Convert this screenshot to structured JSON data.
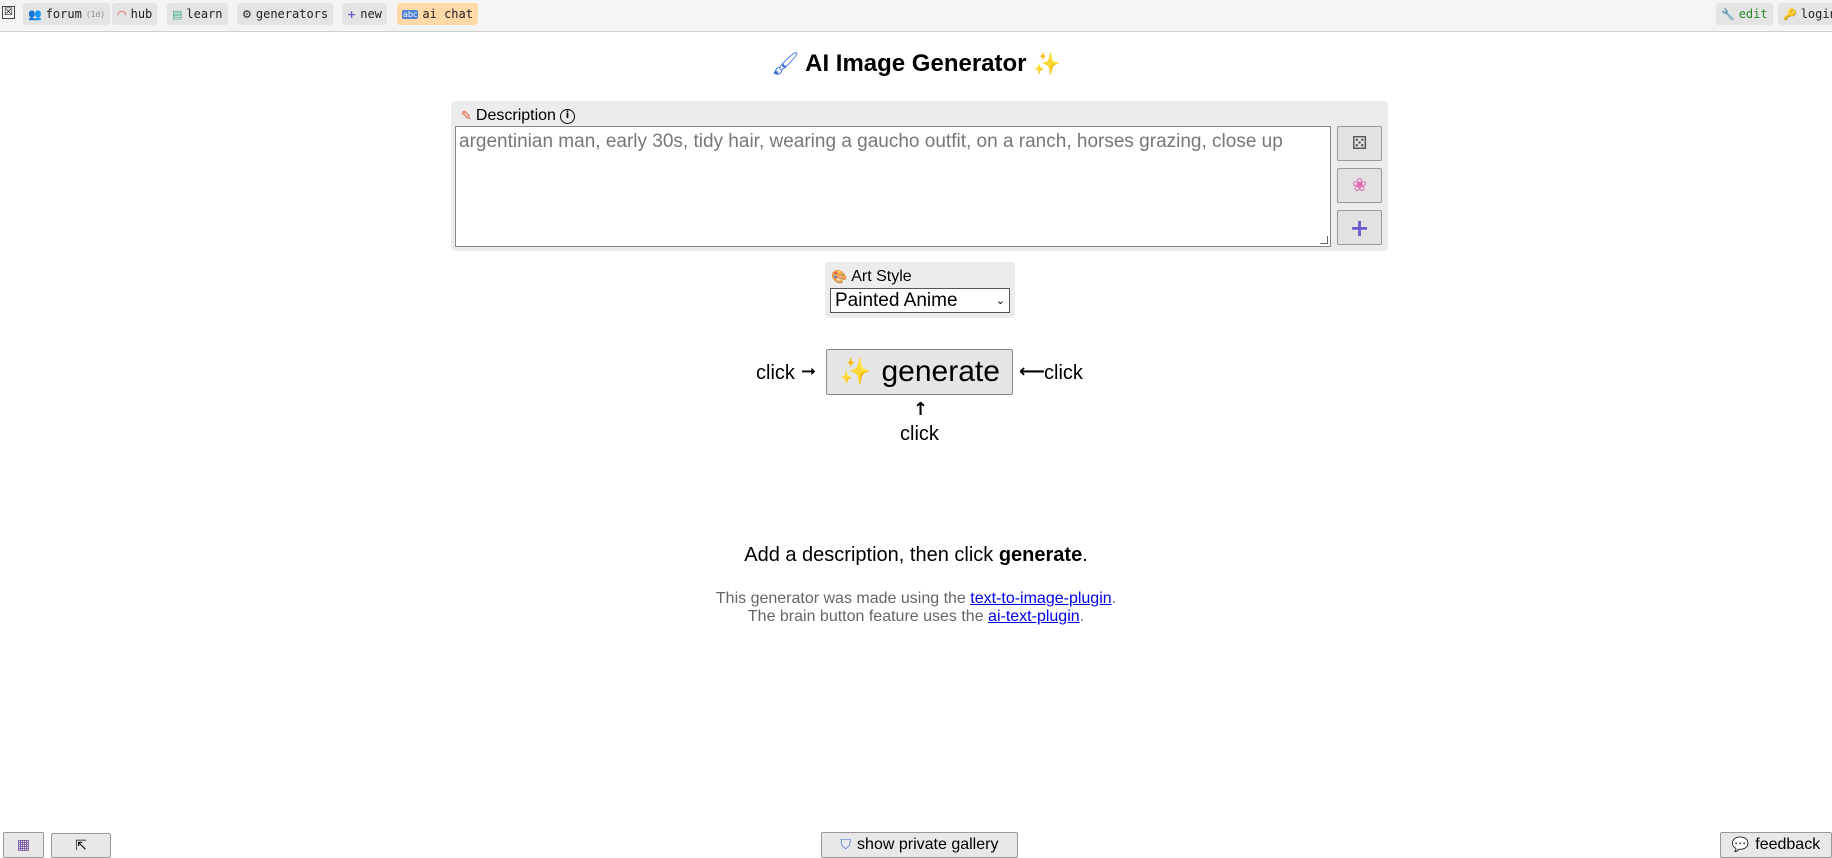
{
  "topbar": {
    "close_icon": "☒",
    "forum": {
      "icon": "people-icon",
      "label": "forum",
      "badge": "(1d)"
    },
    "hub": {
      "icon": "rainbow-icon",
      "label": "hub"
    },
    "learn": {
      "icon": "books-icon",
      "label": "learn"
    },
    "generators": {
      "icon": "gears-icon",
      "label": "generators"
    },
    "new": {
      "icon": "plus-icon",
      "label": "new"
    },
    "ai_chat": {
      "icon": "abc-icon",
      "label": "ai chat"
    },
    "edit": {
      "icon": "wrench-icon",
      "label": "edit"
    },
    "login": {
      "icon": "key-icon",
      "label": "login"
    }
  },
  "page": {
    "title": "AI Image Generator",
    "title_icon_left": "paintbrush-icon",
    "title_icon_right": "magic-wand-icon"
  },
  "description": {
    "label": "Description",
    "value": "argentinian man, early 30s, tidy hair, wearing a gaucho outfit, on a ranch, horses grazing, close up",
    "buttons": [
      "dice-icon",
      "brain-icon",
      "plus-icon"
    ]
  },
  "art_style": {
    "label": "Art Style",
    "selected": "Painted Anime"
  },
  "generate": {
    "label": "generate",
    "click_left": "click",
    "click_right": "click",
    "click_below": "click"
  },
  "hint": {
    "prefix": "Add a description, then click ",
    "bold": "generate",
    "suffix": "."
  },
  "credits": {
    "line1_prefix": "This generator was made using the ",
    "line1_link": "text-to-image-plugin",
    "line1_suffix": ".",
    "line2_prefix": "The brain button feature uses the ",
    "line2_link": "ai-text-plugin",
    "line2_suffix": "."
  },
  "bottom": {
    "gallery_label": "show private gallery",
    "feedback_label": "feedback"
  },
  "colors": {
    "ai_chat_bg": "#ffd9a8",
    "edit_text": "#2a8a2a",
    "link": "#0000ee",
    "plus_button": "#6a5acd"
  }
}
